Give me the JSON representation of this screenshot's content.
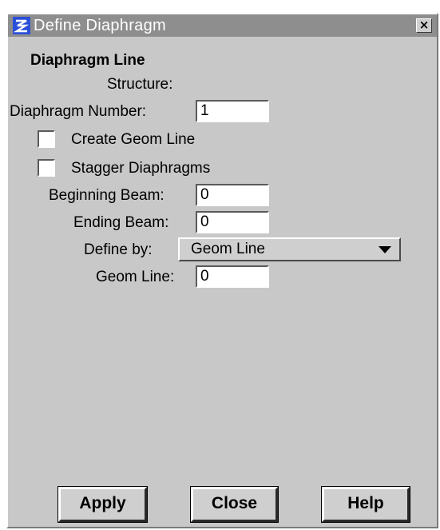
{
  "window": {
    "title": "Define Diaphragm"
  },
  "section_title": "Diaphragm Line",
  "structure_label": "Structure:",
  "diaphragm_number": {
    "label": "Diaphragm Number:",
    "value": "1"
  },
  "create_geom_line": {
    "label": "Create Geom Line",
    "checked": false
  },
  "stagger_diaphragms": {
    "label": "Stagger Diaphragms",
    "checked": false
  },
  "beginning_beam": {
    "label": "Beginning Beam:",
    "value": "0"
  },
  "ending_beam": {
    "label": "Ending Beam:",
    "value": "0"
  },
  "define_by": {
    "label": "Define by:",
    "selected": "Geom Line"
  },
  "geom_line": {
    "label": "Geom Line:",
    "value": "0"
  },
  "buttons": {
    "apply": "Apply",
    "close": "Close",
    "help": "Help"
  },
  "colors": {
    "titlebar": "#8e8e8e",
    "panel": "#c8c8c8",
    "icon_blue": "#2a4fd8"
  }
}
